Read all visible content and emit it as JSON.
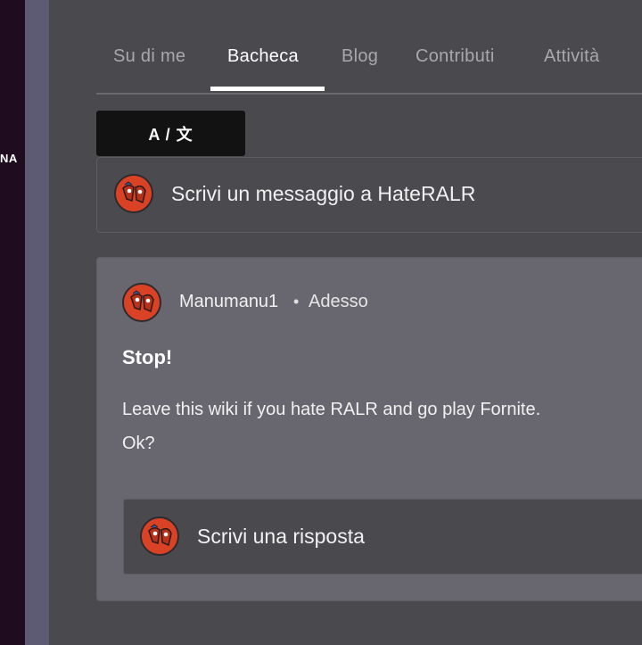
{
  "left_rail": {
    "text": "NA"
  },
  "tabs": [
    {
      "label": "Su di me",
      "active": false
    },
    {
      "label": "Bacheca",
      "active": true
    },
    {
      "label": "Blog",
      "active": false
    },
    {
      "label": "Contributi",
      "active": false
    },
    {
      "label": "Attività",
      "active": false
    }
  ],
  "translate": {
    "label": "A / 文"
  },
  "compose": {
    "placeholder": "Scrivi un messaggio a HateRALR"
  },
  "post": {
    "author": "Manumanu1",
    "separator": "•",
    "time": "Adesso",
    "title": "Stop!",
    "body_line1": "Leave this wiki if you hate RALR and go play Fornite.",
    "body_line2": "Ok?"
  },
  "reply": {
    "placeholder": "Scrivi una risposta"
  },
  "colors": {
    "background": "#4a494e",
    "card": "#686770",
    "rail": "#1f0c1e",
    "stripe": "#5d5b74",
    "avatar": "#d94224",
    "active_tab": "#ffffff",
    "inactive_tab": "#a9a8ad"
  }
}
